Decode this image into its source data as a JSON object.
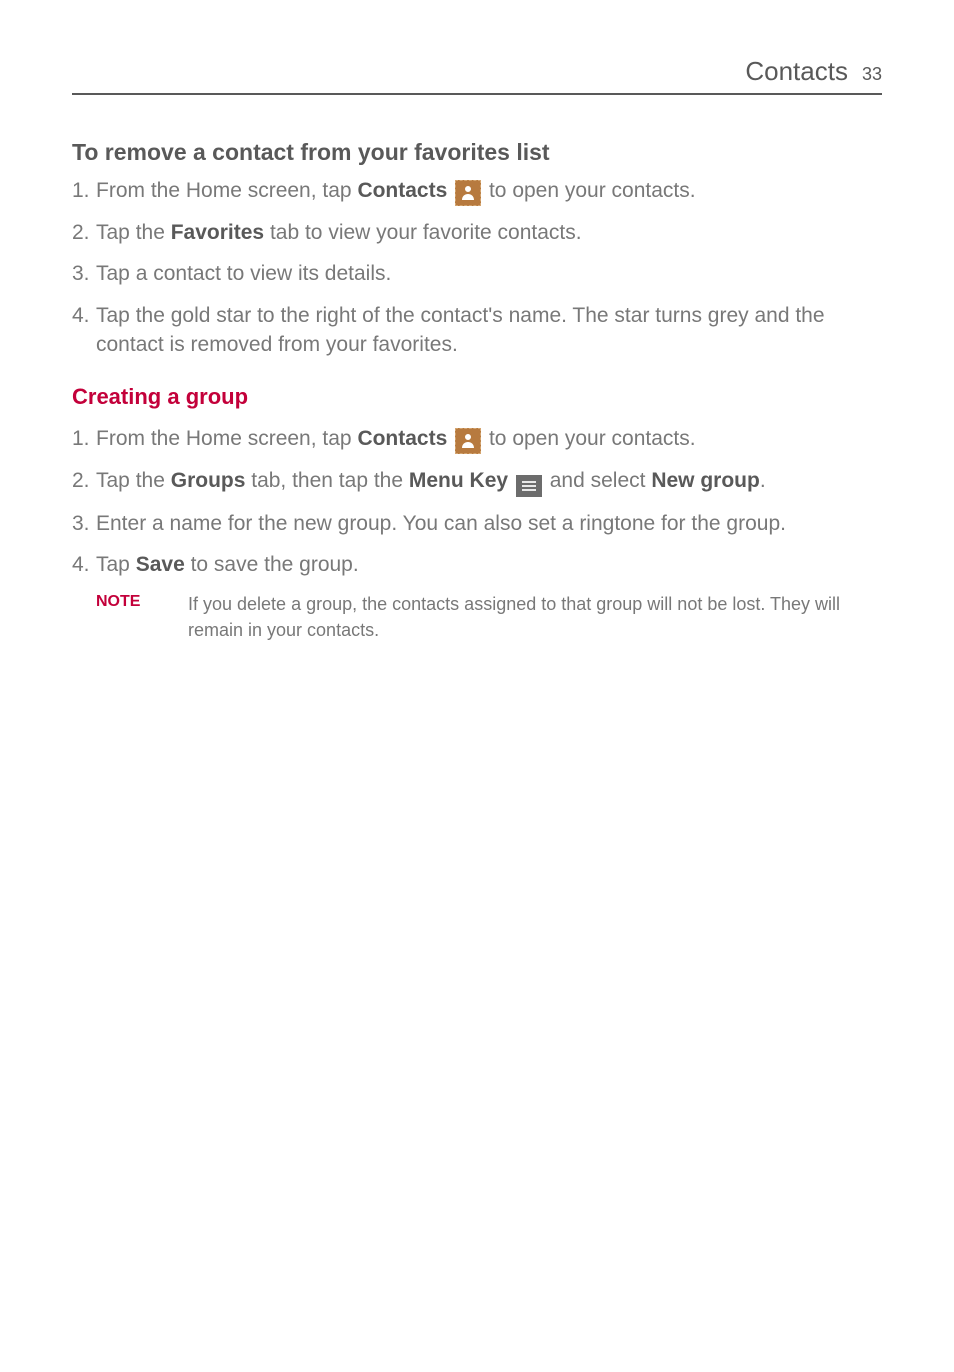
{
  "header": {
    "title": "Contacts",
    "page_number": "33"
  },
  "section_remove": {
    "heading": "To remove a contact from your favorites list",
    "items": [
      {
        "num": "1.",
        "pre": " From the Home screen, tap ",
        "bold1": "Contacts",
        "post": " to open your contacts."
      },
      {
        "num": "2.",
        "pre": " Tap the ",
        "bold1": "Favorites",
        "post": " tab to view your favorite contacts."
      },
      {
        "num": "3.",
        "text": " Tap a contact to view its details."
      },
      {
        "num": "4.",
        "text": " Tap the gold star to the right of the contact's name. The star turns grey and the contact is removed from your favorites."
      }
    ]
  },
  "section_group": {
    "heading": "Creating a group",
    "items": [
      {
        "num": "1.",
        "pre": " From the Home screen, tap ",
        "bold1": "Contacts",
        "post": " to open your contacts."
      },
      {
        "num": "2.",
        "pre": " Tap the ",
        "bold1": "Groups",
        "mid1": " tab, then tap the ",
        "bold2": "Menu Key",
        "mid2": " and select ",
        "bold3": "New group",
        "post": "."
      },
      {
        "num": "3.",
        "text": " Enter a name for the new group. You can also set a ringtone for the group."
      },
      {
        "num": "4.",
        "pre": " Tap ",
        "bold1": "Save",
        "post": " to save the group."
      }
    ],
    "note": {
      "label": "NOTE",
      "text": "If you delete a group, the contacts assigned to that group will not be lost. They will remain in your contacts."
    }
  }
}
